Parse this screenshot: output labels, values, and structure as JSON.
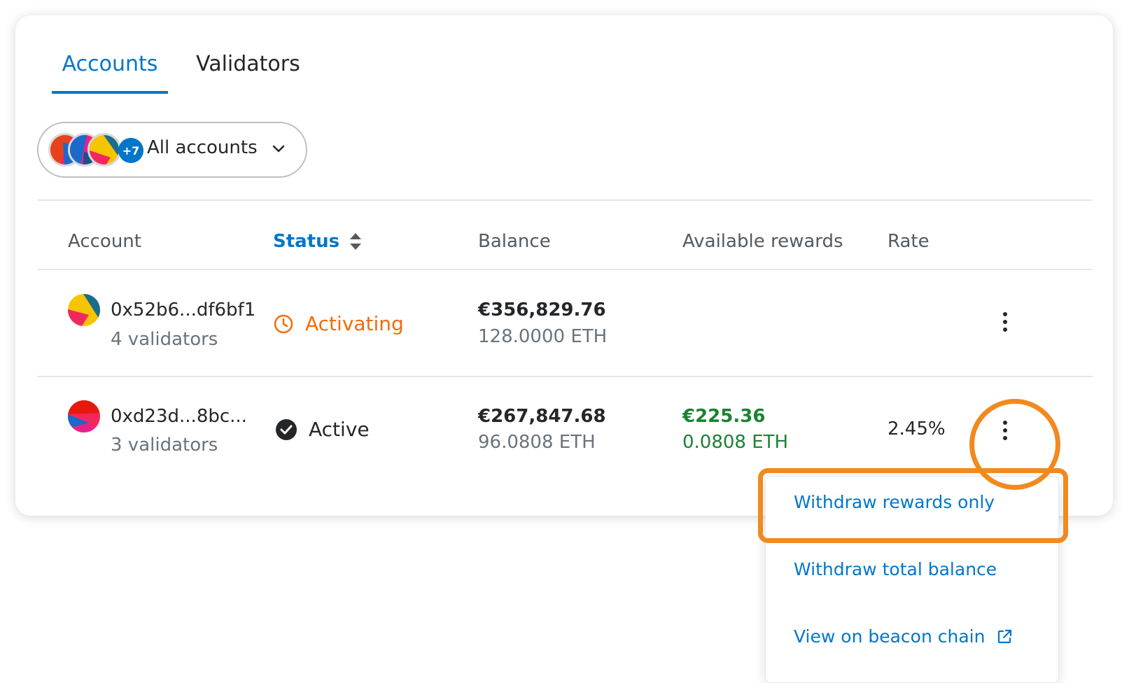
{
  "tabs": [
    {
      "label": "Accounts",
      "active": true
    },
    {
      "label": "Validators",
      "active": false
    }
  ],
  "account_selector": {
    "more_count": "+7",
    "label": "All accounts"
  },
  "table": {
    "headers": {
      "account": "Account",
      "status": "Status",
      "balance": "Balance",
      "rewards": "Available rewards",
      "rate": "Rate"
    },
    "rows": [
      {
        "address": "0x52b6...df6bf1",
        "validators": "4 validators",
        "status": "Activating",
        "status_color": "#f66a0a",
        "balance_fiat": "€356,829.76",
        "balance_eth": "128.0000 ETH",
        "rewards_fiat": "",
        "rewards_eth": "",
        "rate": ""
      },
      {
        "address": "0xd23d...8bc...",
        "validators": "3 validators",
        "status": "Active",
        "status_color": "#24272a",
        "balance_fiat": "€267,847.68",
        "balance_eth": "96.0808 ETH",
        "rewards_fiat": "€225.36",
        "rewards_eth": "0.0808 ETH",
        "rate": "2.45%"
      }
    ]
  },
  "menu": {
    "items": [
      {
        "label": "Withdraw rewards only"
      },
      {
        "label": "Withdraw total balance"
      },
      {
        "label": "View on beacon chain",
        "icon": "external-link-icon"
      }
    ]
  },
  "colors": {
    "primary": "#0376c9",
    "highlight": "#f08a1e",
    "success": "#1c8234",
    "warning": "#f66a0a"
  }
}
